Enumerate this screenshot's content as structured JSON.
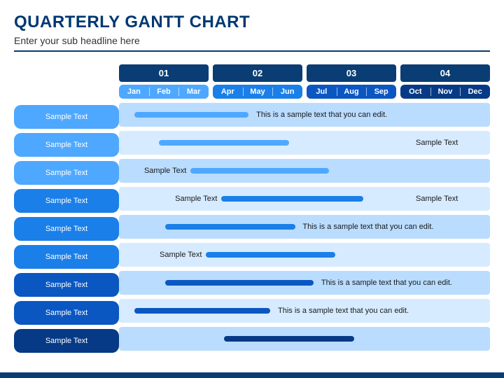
{
  "title": "Quarterly Gantt Chart",
  "subtitle": "Enter your sub headline here",
  "palette": {
    "tint1": "#4ea8ff",
    "tint2": "#1a7fe8",
    "tint3": "#0a57c2",
    "tint4": "#073a86",
    "row_even": "#d6ebff",
    "row_odd": "#b9dcff",
    "header_dark": "#0a3d73"
  },
  "chart_data": {
    "type": "bar",
    "title": "Quarterly Gantt Chart",
    "xlabel": "",
    "ylabel": "",
    "quarters": [
      "01",
      "02",
      "03",
      "04"
    ],
    "months": [
      "Jan",
      "Feb",
      "Mar",
      "Apr",
      "May",
      "Jun",
      "Jul",
      "Aug",
      "Sep",
      "Oct",
      "Nov",
      "Dec"
    ],
    "xlim": [
      0,
      12
    ],
    "series": [
      {
        "name": "Sample Text",
        "start": 0.5,
        "end": 4.2,
        "tier": 1,
        "annotation": "This is a sample text that you can edit.",
        "annot_side": "right"
      },
      {
        "name": "Sample Text",
        "start": 1.3,
        "end": 5.5,
        "tier": 1,
        "annotation": "Sample Text",
        "annot_side": "far-right"
      },
      {
        "name": "Sample Text",
        "start": 2.3,
        "end": 6.8,
        "tier": 1,
        "annotation": "Sample Text",
        "annot_side": "left"
      },
      {
        "name": "Sample Text",
        "start": 3.3,
        "end": 7.9,
        "tier": 2,
        "annotation": "Sample Text",
        "annot_side": "left",
        "annotation2": "Sample Text",
        "annot2_side": "far-right"
      },
      {
        "name": "Sample Text",
        "start": 1.5,
        "end": 5.7,
        "tier": 2,
        "annotation": "This is a sample text that you can edit.",
        "annot_side": "right"
      },
      {
        "name": "Sample Text",
        "start": 2.8,
        "end": 7.0,
        "tier": 2,
        "annotation": "Sample Text",
        "annot_side": "left"
      },
      {
        "name": "Sample Text",
        "start": 1.5,
        "end": 6.3,
        "tier": 3,
        "annotation": "This is a sample text that you can edit.",
        "annot_side": "right"
      },
      {
        "name": "Sample Text",
        "start": 0.5,
        "end": 4.9,
        "tier": 3,
        "annotation": "This is a sample text that you can edit.",
        "annot_side": "right"
      },
      {
        "name": "Sample Text",
        "start": 3.4,
        "end": 7.6,
        "tier": 4,
        "annotation": "",
        "annot_side": ""
      }
    ]
  }
}
